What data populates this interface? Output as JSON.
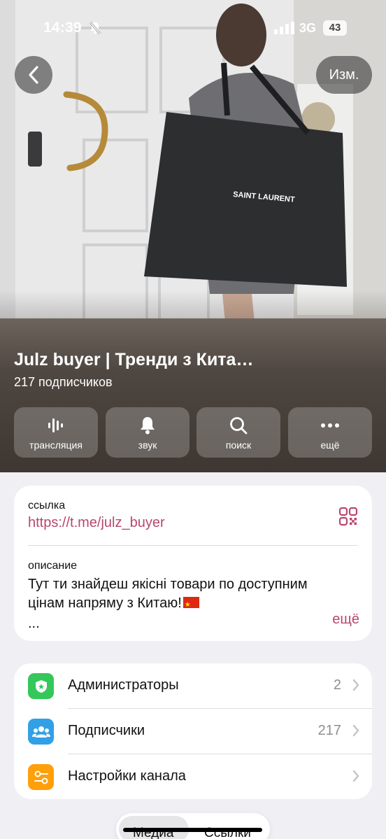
{
  "status_bar": {
    "time": "14:39",
    "network": "3G",
    "battery": "43",
    "icons": [
      "bell-slash-icon",
      "signal-icon"
    ]
  },
  "header": {
    "edit_label": "Изм.",
    "channel_title": "Julz buyer | Тренди з Кита…",
    "subscribers_text": "217 подписчиков",
    "photo_bag_text": "SAINT LAURENT"
  },
  "actions": [
    {
      "label": "трансляция",
      "icon": "live-stream-icon"
    },
    {
      "label": "звук",
      "icon": "bell-icon"
    },
    {
      "label": "поиск",
      "icon": "search-icon"
    },
    {
      "label": "ещё",
      "icon": "more-icon"
    }
  ],
  "info": {
    "link_label": "ссылка",
    "link_value": "https://t.me/julz_buyer",
    "description_label": "описание",
    "description_line1": "Тут ти знайдеш якісні товари по доступним",
    "description_line2": "цінам напряму з Китаю!",
    "description_ellipsis": "...",
    "more_label": "ещё"
  },
  "menu": [
    {
      "label": "Администраторы",
      "value": "2",
      "icon": "admin-shield-icon",
      "color": "#34c759"
    },
    {
      "label": "Подписчики",
      "value": "217",
      "icon": "subscribers-icon",
      "color": "#32a0e6"
    },
    {
      "label": "Настройки канала",
      "value": "",
      "icon": "settings-toggle-icon",
      "color": "#ff9f0a"
    }
  ],
  "tabs": [
    {
      "label": "Медиа"
    },
    {
      "label": "Ссылки"
    }
  ],
  "colors": {
    "accent": "#b8476c",
    "background": "#efeff4"
  }
}
